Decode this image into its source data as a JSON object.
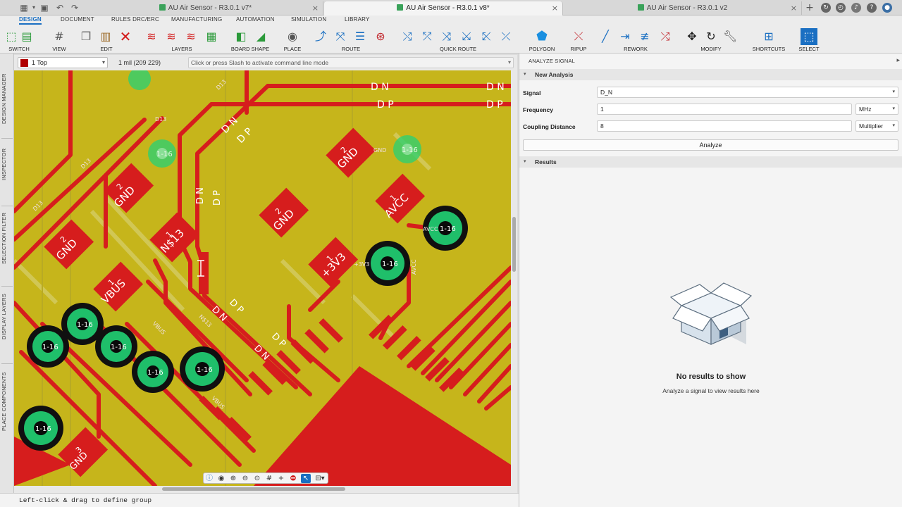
{
  "tabs": [
    {
      "title": "AU Air Sensor - R3.0.1 v7*",
      "active": false
    },
    {
      "title": "AU Air Sensor - R3.0.1 v8*",
      "active": true
    },
    {
      "title": "AU Air Sensor - R3.0.1 v2",
      "active": false
    }
  ],
  "menu_tabs": [
    "DESIGN",
    "DOCUMENT",
    "RULES DRC/ERC",
    "MANUFACTURING",
    "AUTOMATION",
    "SIMULATION",
    "LIBRARY"
  ],
  "toolbar_groups": [
    "SWITCH",
    "VIEW",
    "EDIT",
    "LAYERS",
    "BOARD SHAPE",
    "PLACE",
    "ROUTE",
    "QUICK ROUTE",
    "POLYGON",
    "RIPUP",
    "REWORK",
    "MODIFY",
    "SHORTCUTS",
    "SELECT"
  ],
  "left_rail": [
    "DESIGN MANAGER",
    "INSPECTOR",
    "SELECTION FILTER",
    "DISPLAY LAYERS",
    "PLACE COMPONENTS"
  ],
  "canvas": {
    "layer": "1 Top",
    "layer_color": "#b00000",
    "grid_info": "1 mil (209 229)",
    "command_placeholder": "Click or press Slash to activate command line mode"
  },
  "pcb_labels": {
    "dn": "D N",
    "dp": "D P",
    "gnd": "GND",
    "avcc": "AVCC",
    "v3": "+3V3",
    "vbus": "VBUS",
    "ns13": "N$13",
    "d13": "D13",
    "via": "1-16",
    "pad1": "1",
    "pad2": "2",
    "pad3": "3"
  },
  "status": "Left-click & drag to define group",
  "panel": {
    "title": "ANALYZE SIGNAL",
    "new_analysis": "New Analysis",
    "signal_label": "Signal",
    "signal_value": "D_N",
    "frequency_label": "Frequency",
    "frequency_value": "1",
    "frequency_unit": "MHz",
    "coupling_label": "Coupling Distance",
    "coupling_value": "8",
    "coupling_unit": "Multiplier",
    "analyze_button": "Analyze",
    "results": "Results",
    "empty_title": "No results to show",
    "empty_sub": "Analyze a signal to view results here"
  },
  "colors": {
    "copper": "#d61d1d",
    "board": "#c6b51b",
    "via": "#1fbf6a",
    "accent": "#1a6fc2"
  }
}
